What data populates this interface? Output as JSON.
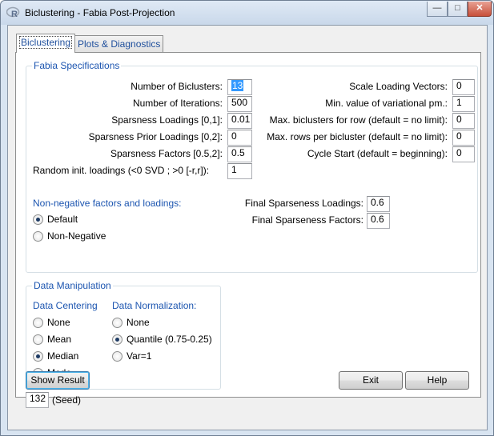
{
  "window": {
    "title": "Biclustering - Fabia Post-Projection",
    "controls": {
      "minimize": "—",
      "maximize": "□",
      "close": "✕"
    }
  },
  "tabs": [
    {
      "label": "Biclustering",
      "active": true
    },
    {
      "label": "Plots & Diagnostics",
      "active": false
    }
  ],
  "fabia_specs": {
    "title": "Fabia Specifications",
    "left_fields": [
      {
        "label": "Number of Biclusters:",
        "value": "13",
        "selected": true
      },
      {
        "label": "Number of Iterations:",
        "value": "500"
      },
      {
        "label": "Sparsness Loadings [0,1]:",
        "value": "0.01"
      },
      {
        "label": "Sparsness Prior Loadings [0,2]:",
        "value": "0"
      },
      {
        "label": "Sparsness Factors [0.5,2]:",
        "value": "0.5"
      },
      {
        "label": "Random init. loadings (<0 SVD ; >0 [-r,r]):",
        "value": "1"
      }
    ],
    "right_fields": [
      {
        "label": "Scale Loading Vectors:",
        "value": "0"
      },
      {
        "label": "Min. value of variational pm.:",
        "value": "1"
      },
      {
        "label": "Max. biclusters for row (default = no limit):",
        "value": "0"
      },
      {
        "label": "Max. rows per bicluster (default = no limit):",
        "value": "0"
      },
      {
        "label": "Cycle Start (default = beginning):",
        "value": "0"
      }
    ],
    "nonneg_title": "Non-negative factors and loadings:",
    "nonneg_options": [
      {
        "label": "Default",
        "checked": true
      },
      {
        "label": "Non-Negative",
        "checked": false
      }
    ],
    "final_fields": [
      {
        "label": "Final Sparseness Loadings:",
        "value": "0.6"
      },
      {
        "label": "Final Sparseness Factors:",
        "value": "0.6"
      }
    ]
  },
  "data_manipulation": {
    "title": "Data Manipulation",
    "centering": {
      "title": "Data Centering",
      "options": [
        {
          "label": "None",
          "checked": false
        },
        {
          "label": "Mean",
          "checked": false
        },
        {
          "label": "Median",
          "checked": true
        },
        {
          "label": "Mode",
          "checked": false
        }
      ]
    },
    "normalization": {
      "title": "Data Normalization:",
      "options": [
        {
          "label": "None",
          "checked": false
        },
        {
          "label": "Quantile (0.75-0.25)",
          "checked": true
        },
        {
          "label": "Var=1",
          "checked": false
        }
      ]
    }
  },
  "footer": {
    "show_result": "Show Result",
    "exit": "Exit",
    "help": "Help",
    "seed_value": "132",
    "seed_label": "(Seed)"
  }
}
